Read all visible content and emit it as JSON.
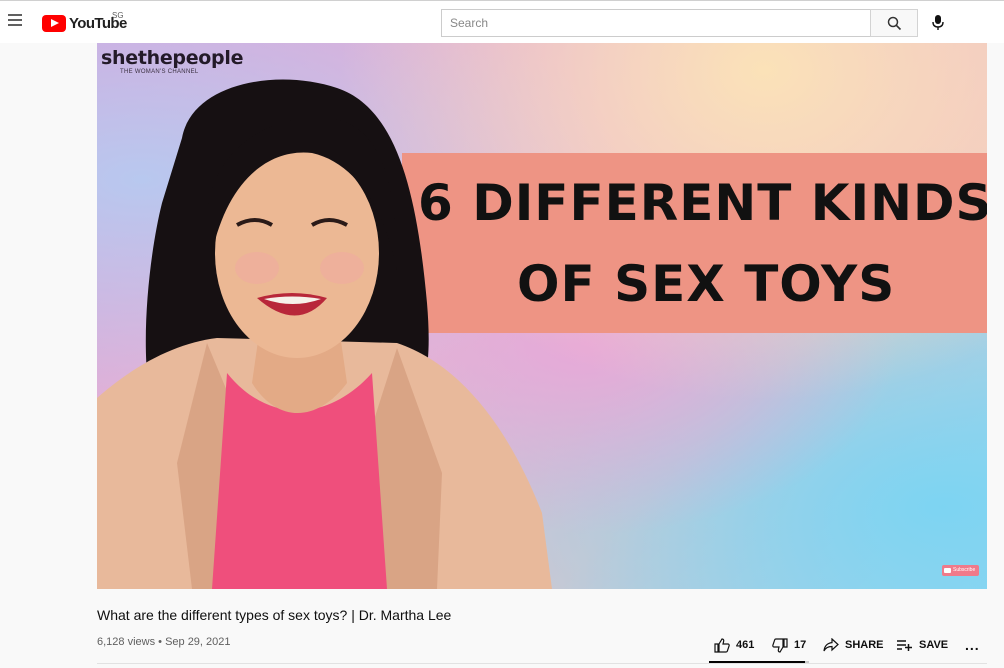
{
  "masthead": {
    "logo_text": "YouTube",
    "country_code": "SG",
    "search_placeholder": "Search"
  },
  "video": {
    "channel_brand": "shethepeople",
    "channel_tagline": "THE WOMAN'S CHANNEL",
    "banner_line1": "6 DIFFERENT KINDS",
    "banner_line2": "OF SEX TOYS",
    "subscribe_badge": "Subscribe",
    "title": "What are the different types of sex toys? | Dr. Martha Lee",
    "views": "6,128 views",
    "date": "Sep 29, 2021",
    "meta_separator": " • "
  },
  "actions": {
    "likes": "461",
    "dislikes": "17",
    "share_label": "SHARE",
    "save_label": "SAVE",
    "more_label": "...",
    "like_fraction": 0.964
  },
  "colors": {
    "brand_red": "#ff0000",
    "banner_bg": "#ee9484",
    "page_bg": "#f9f9f9"
  },
  "icons": [
    "hamburger-icon",
    "youtube-logo-icon",
    "search-icon",
    "mic-icon",
    "thumb-up-icon",
    "thumb-down-icon",
    "share-icon",
    "save-playlist-icon",
    "more-icon"
  ]
}
